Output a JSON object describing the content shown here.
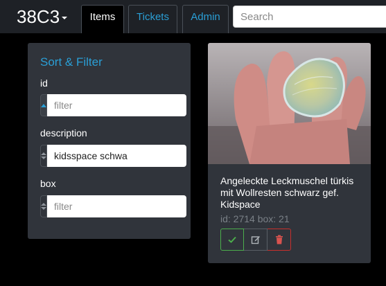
{
  "navbar": {
    "brand": "38C3",
    "tabs": [
      {
        "label": "Items",
        "active": true
      },
      {
        "label": "Tickets",
        "active": false
      },
      {
        "label": "Admin",
        "active": false
      }
    ],
    "search_placeholder": "Search"
  },
  "filter_panel": {
    "title": "Sort & Filter",
    "fields": [
      {
        "label": "id",
        "value": "",
        "placeholder": "filter",
        "sort_icon": "sort-ascending-icon"
      },
      {
        "label": "description",
        "value": "kidsspace schwa",
        "placeholder": "filter",
        "sort_icon": "sort-unsorted-icon"
      },
      {
        "label": "box",
        "value": "",
        "placeholder": "filter",
        "sort_icon": "sort-unsorted-icon"
      }
    ]
  },
  "item_card": {
    "description": "Angeleckte Leckmuschel türkis mit Wollresten schwarz gef. Kidspace",
    "meta": "id: 2714 box: 21",
    "actions": [
      "check-icon",
      "edit-icon",
      "trash-icon"
    ]
  },
  "colors": {
    "accent": "#2a9fd6",
    "panel": "#30343b",
    "success": "#4cae4c",
    "danger": "#d9534f"
  }
}
